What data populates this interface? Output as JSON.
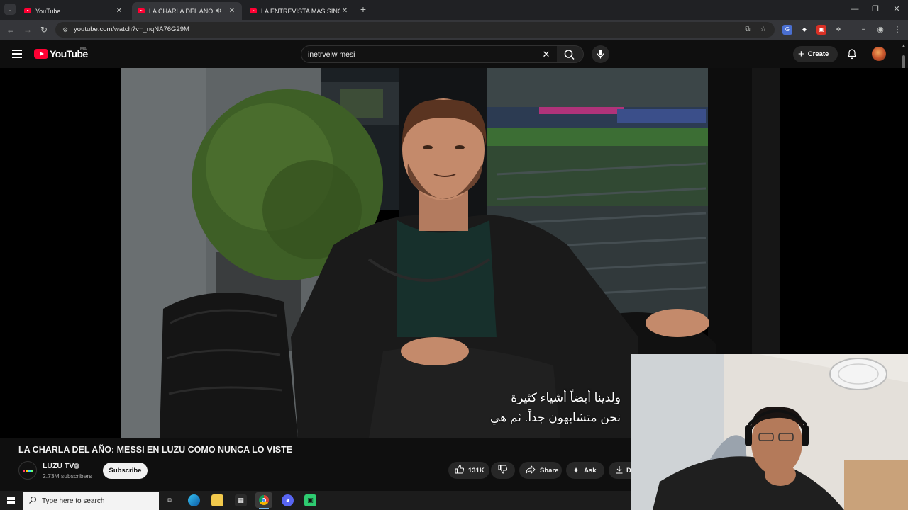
{
  "browser": {
    "tabs": [
      {
        "label": "YouTube",
        "active": false
      },
      {
        "label": "LA CHARLA DEL AÑO: MESS",
        "active": true,
        "audio": true
      },
      {
        "label": "LA ENTREVISTA MÁS SINCERA",
        "active": false
      }
    ],
    "url": "youtube.com/watch?v=_nqNA76G29M"
  },
  "youtube": {
    "logo_text": "YouTube",
    "country_code": "MA",
    "search_query": "inetrveiw mesi",
    "create_label": "Create"
  },
  "video": {
    "subtitle_line1": "ولدينا أيضاً أشياء كثيرة",
    "subtitle_line2": "نحن متشابهون جداً. ثم هي",
    "title": "LA CHARLA DEL AÑO: MESSI EN LUZU COMO NUNCA LO VISTE"
  },
  "channel": {
    "name": "LUZU TV",
    "subscribers": "2.73M subscribers",
    "subscribe_label": "Subscribe"
  },
  "actions": {
    "likes": "131K",
    "share": "Share",
    "ask": "Ask",
    "download_partial": "D"
  },
  "taskbar": {
    "search_placeholder": "Type here to search"
  },
  "colors": {
    "youtube_red": "#ff0033",
    "background": "#0f0f0f",
    "chrome_toolbar": "#35363a"
  }
}
